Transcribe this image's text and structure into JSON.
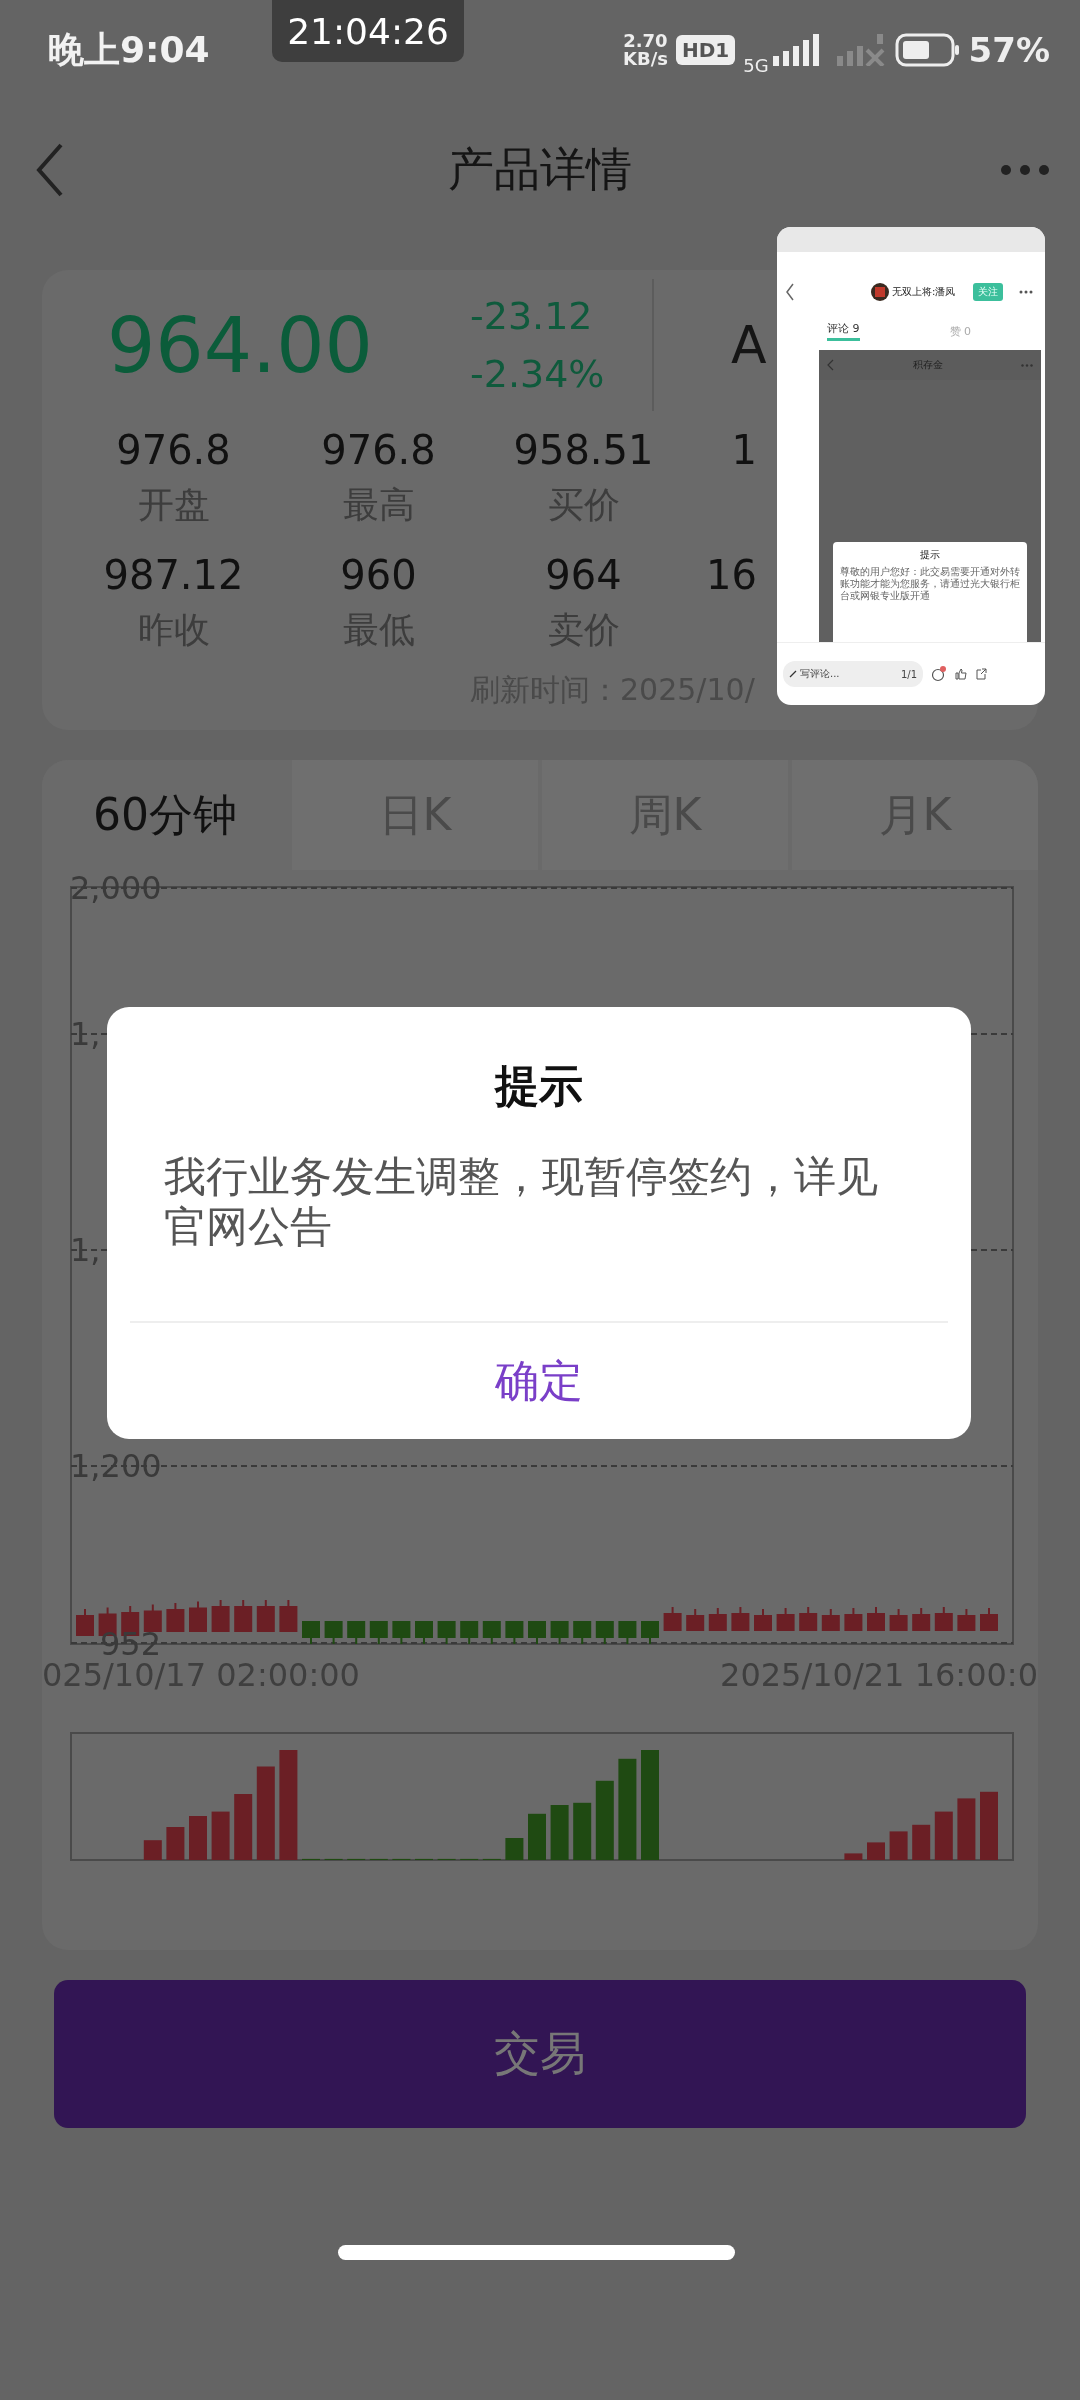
{
  "status_bar": {
    "time": "晚上9:04",
    "clock_overlay": "21:04:26",
    "net_speed": "2.70",
    "net_speed_unit": "KB/s",
    "hd_badge": "HD1",
    "network": "5G",
    "battery": "57%"
  },
  "nav": {
    "title": "产品详情"
  },
  "quote": {
    "price": "964.00",
    "change": "-23.12",
    "change_pct": "-2.34%",
    "column_4": "A",
    "stats": [
      [
        {
          "value": "976.8",
          "label": "开盘"
        },
        {
          "value": "976.8",
          "label": "最高"
        },
        {
          "value": "958.51",
          "label": "买价"
        },
        {
          "value": "1"
        }
      ],
      [
        {
          "value": "987.12",
          "label": "昨收"
        },
        {
          "value": "960",
          "label": "最低"
        },
        {
          "value": "964",
          "label": "卖价"
        },
        {
          "value": "16"
        }
      ]
    ],
    "refresh": "刷新时间：2025/10/"
  },
  "tabs": [
    {
      "label": "60分钟",
      "selected": true
    },
    {
      "label": "日K",
      "selected": false
    },
    {
      "label": "周K",
      "selected": false
    },
    {
      "label": "月K",
      "selected": false
    }
  ],
  "chart": {
    "y_labels": [
      "2,000",
      "1,",
      "1,",
      "1,200",
      "952"
    ],
    "x_labels": [
      "025/10/17 02:00:00",
      "2025/10/21 16:00:0"
    ]
  },
  "trade_button": "交易",
  "dialog": {
    "title": "提示",
    "message": "我行业务发生调整，现暂停签约，详见官网公告",
    "confirm": "确定"
  },
  "thumbnail": {
    "user": "无双上将:潘凤",
    "follow": "关注",
    "tabs": [
      {
        "label": "评论 9",
        "selected": true
      },
      {
        "label": "赞 0",
        "selected": false
      }
    ],
    "inner_title": "积存金",
    "inner_dialog_title": "提示",
    "inner_dialog_text": "尊敬的用户您好：此交易需要开通对外转账功能才能为您服务，请通过光大银行柜台或网银专业版开通",
    "comment_placeholder": "写评论...",
    "page_counter": "1/1"
  }
}
